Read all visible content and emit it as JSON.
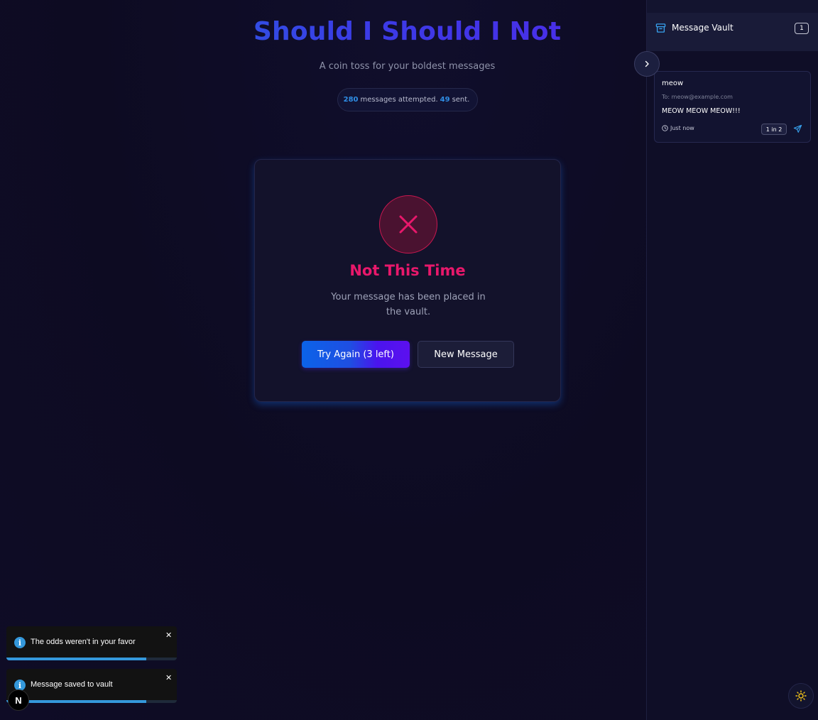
{
  "header": {
    "title": "Should I Should I Not",
    "subtitle": "A coin toss for your boldest messages",
    "stats": {
      "attempted": "280",
      "attempted_label": "messages attempted.",
      "sent": "49",
      "sent_label": "sent."
    }
  },
  "result": {
    "icon": "x-icon",
    "title": "Not This Time",
    "message": "Your message has been placed in the vault.",
    "try_again_label": "Try Again (3 left)",
    "new_message_label": "New Message"
  },
  "vault": {
    "title": "Message Vault",
    "count": "1",
    "messages": [
      {
        "subject": "meow",
        "to": "To: meow@example.com",
        "body": "MEOW MEOW MEOW!!!",
        "time": "Just now",
        "odds": "1 in 2"
      }
    ]
  },
  "toasts": [
    {
      "text": "The odds weren't in your favor",
      "progress": 0.82
    },
    {
      "text": "Message saved to vault",
      "progress": 0.82
    }
  ],
  "dev_badge": "N",
  "colors": {
    "background": "#0d0b22",
    "accent_blue": "#2f8ee6",
    "accent_purple": "#5c10ef",
    "error_pink": "#e8186b",
    "toast_info": "#3498db"
  }
}
